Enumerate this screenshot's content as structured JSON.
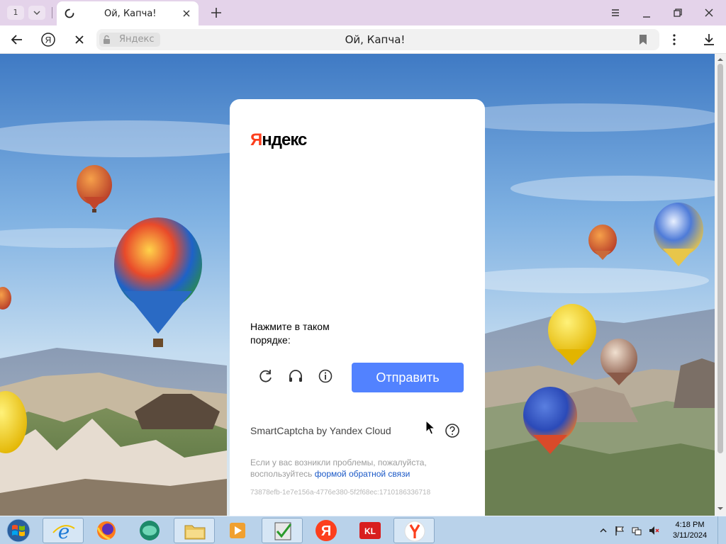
{
  "tabbar": {
    "tab_count": "1",
    "active_tab_title": "Ой, Капча!"
  },
  "navbar": {
    "domain": "Яндекс",
    "page_title": "Ой, Капча!"
  },
  "captcha": {
    "logo_first": "Я",
    "logo_rest": "ндекс",
    "instruction": "Нажмите в таком порядке:",
    "submit_label": "Отправить",
    "brand_line": "SmartCaptcha by Yandex Cloud",
    "problem_text": "Если у вас возникли проблемы, пожалуйста, воспользуйтесь ",
    "problem_link": "формой обратной связи",
    "token": "73878efb-1e7e156a-4776e380-5f2f68ec:1710186336718"
  },
  "taskbar": {
    "time": "4:18 PM",
    "date": "3/11/2024"
  },
  "colors": {
    "tabbar_bg": "#e4d3ea",
    "submit_button": "#5282ff",
    "yandex_red": "#fc3f1d",
    "link": "#1a58c7",
    "taskbar_bg": "#b9d2ea"
  },
  "icons": {
    "tab_loading": "loading-spinner-icon",
    "tab_close": "close-icon",
    "new_tab": "plus-icon",
    "menu": "hamburger-icon",
    "minimize": "minimize-icon",
    "restore": "restore-icon",
    "close_window": "close-icon",
    "back": "back-arrow-icon",
    "yandex": "yandex-ya-icon",
    "stop": "close-icon",
    "lock": "lock-icon",
    "bookmark": "bookmark-icon",
    "more": "vertical-dots-icon",
    "download": "download-icon",
    "refresh": "refresh-icon",
    "audio": "headphones-icon",
    "info": "info-icon",
    "help": "question-icon"
  }
}
